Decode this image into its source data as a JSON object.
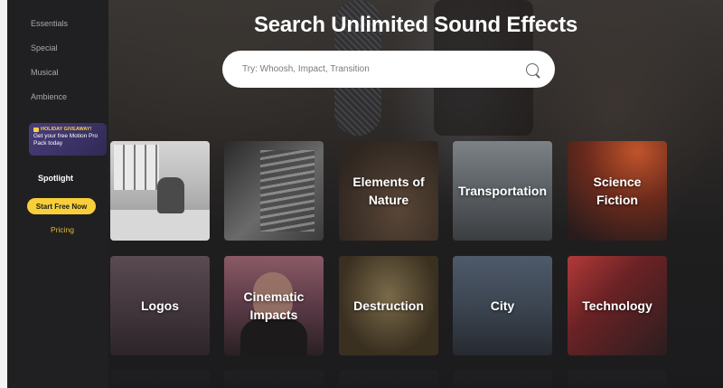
{
  "sidebar": {
    "items": [
      {
        "label": "Essentials"
      },
      {
        "label": "Special"
      },
      {
        "label": "Musical"
      },
      {
        "label": "Ambience"
      }
    ],
    "promo": {
      "tag": "HOLIDAY GIVEAWAY!",
      "text": "Get your free Motion Pro Pack today"
    },
    "spotlight": "Spotlight",
    "cta": "Start Free Now",
    "pricing": "Pricing"
  },
  "hero": {
    "headline": "Search Unlimited Sound Effects",
    "search_placeholder": "Try: Whoosh, Impact, Transition"
  },
  "categories": [
    {
      "label": ""
    },
    {
      "label": ""
    },
    {
      "label": "Elements of Nature"
    },
    {
      "label": "Transportation"
    },
    {
      "label": "Science Fiction"
    },
    {
      "label": "Logos"
    },
    {
      "label": "Cinematic Impacts"
    },
    {
      "label": "Destruction"
    },
    {
      "label": "City"
    },
    {
      "label": "Technology"
    }
  ],
  "colors": {
    "accent": "#f8cf3a",
    "pricing": "#e1b93a",
    "promo": "#3a3266"
  }
}
